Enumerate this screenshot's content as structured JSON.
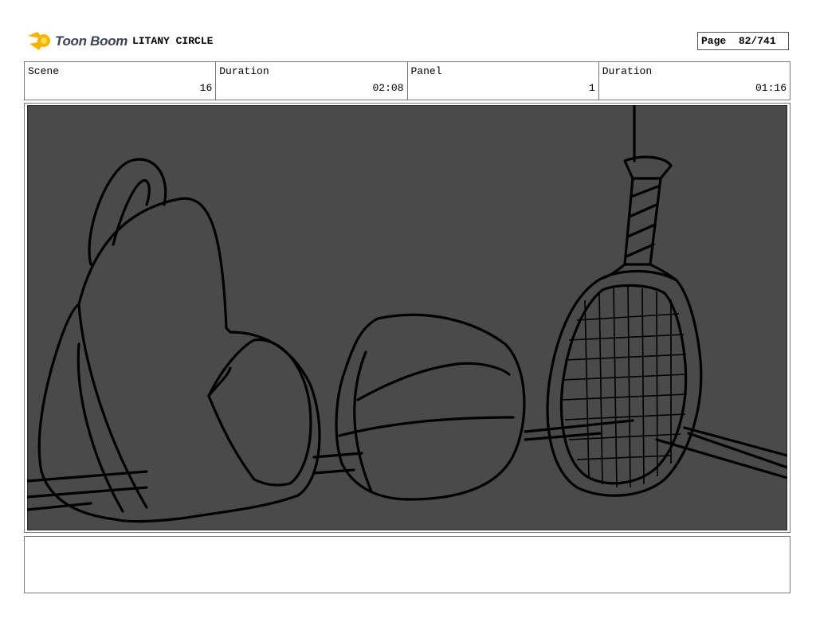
{
  "header": {
    "brand": "Toon Boom",
    "project_title": "LITANY CIRCLE",
    "page_label": "Page",
    "page_value": "82/741"
  },
  "info": [
    {
      "label": "Scene",
      "value": "16"
    },
    {
      "label": "Duration",
      "value": "02:08"
    },
    {
      "label": "Panel",
      "value": "1"
    },
    {
      "label": "Duration",
      "value": "01:16"
    }
  ],
  "panel": {
    "background_color": "#4a4a4a",
    "line_color": "#000000"
  },
  "notes": {
    "text": ""
  }
}
